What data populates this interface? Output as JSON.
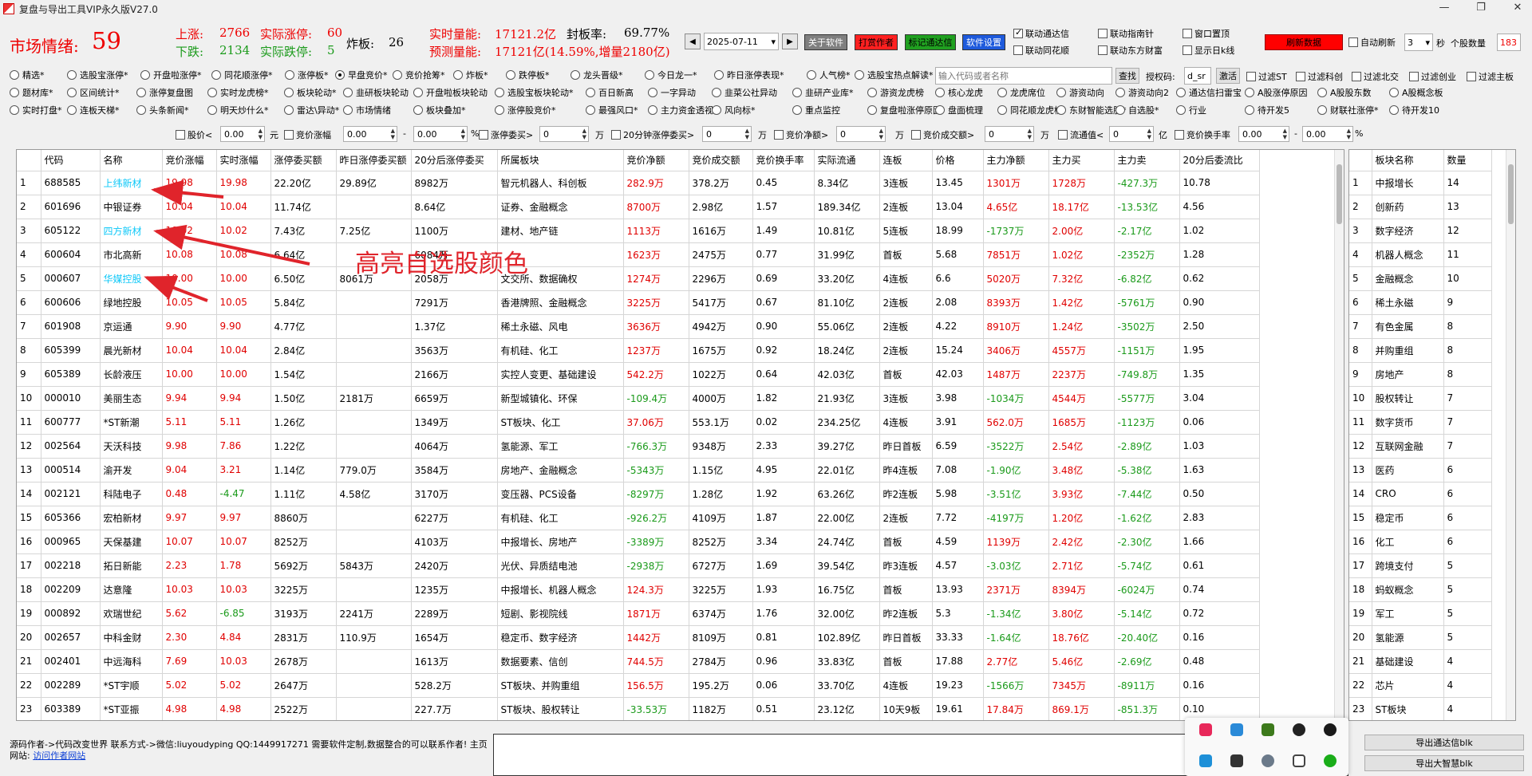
{
  "window": {
    "title": "复盘与导出工具VIP永久版V27.0"
  },
  "header": {
    "mood_label": "市场情绪:",
    "mood_value": "59",
    "up_label": "上涨:",
    "up_value": "2766",
    "real_limit_up_label": "实际涨停:",
    "real_limit_up_value": "60",
    "down_label": "下跌:",
    "down_value": "2134",
    "real_limit_down_label": "实际跌停:",
    "real_limit_down_value": "5",
    "broken_label": "炸板:",
    "broken_value": "26",
    "realtime_vol_label": "实时量能:",
    "realtime_vol_value": "17121.2亿",
    "seal_rate_label": "封板率:",
    "seal_rate_value": "69.77%",
    "forecast_vol_label": "预测量能:",
    "forecast_vol_value": "17121亿(14.59%,增量2180亿)"
  },
  "toolbar": {
    "date": "2025-07-11",
    "about": "关于软件",
    "tip": "打赏作者",
    "mark_tdx": "标记通达信",
    "settings": "软件设置",
    "link_tdx": "联动通达信",
    "link_tonghuashun": "联动同花顺",
    "link_compass": "联动指南针",
    "link_eastmoney": "联动东方财富",
    "window_top": "窗口置顶",
    "show_k": "显示日k线",
    "refresh": "刷新数据",
    "auto_refresh": "自动刷新",
    "interval": "3",
    "sec": "秒",
    "count_label": "个股数量",
    "count": "183"
  },
  "radios": {
    "row1": [
      "精选*",
      "选股宝涨停*",
      "开盘啦涨停*",
      "同花顺涨停*",
      "涨停板*",
      "早盘竞价*",
      "竞价抢筹*",
      "炸板*",
      "跌停板*",
      "龙头晋级*",
      "今日龙一*",
      "昨日涨停表现*",
      "人气榜*",
      "选股宝热点解读*"
    ],
    "row2": [
      "题材库*",
      "区间统计*",
      "涨停复盘图",
      "实时龙虎榜*",
      "板块轮动*",
      "韭研板块轮动",
      "开盘啦板块轮动",
      "选股宝板块轮动*",
      "百日新高",
      "一字异动",
      "韭菜公社异动",
      "韭研产业库*",
      "游资龙虎榜",
      "核心龙虎",
      "龙虎席位",
      "游资动向",
      "游资动向2",
      "通达信扫雷宝",
      "A股涨停原因",
      "A股股东数",
      "A股概念板"
    ],
    "row3": [
      "实时打盘*",
      "连板天梯*",
      "头条新闻*",
      "明天炒什么*",
      "雷达\\异动*",
      "市场情绪",
      "板块叠加*",
      "涨停股竞价*",
      "最强风口*",
      "主力资金透视*",
      "风向标*",
      "重点监控",
      "复盘啦涨停原因",
      "盘面梳理",
      "同花顺龙虎榜",
      "东财智能选股*",
      "自选股*",
      "行业",
      "待开发5",
      "财联社涨停*",
      "待开发10"
    ],
    "search_placeholder": "输入代码或者名称",
    "search_btn": "查找",
    "auth_label": "授权码:",
    "auth_value": "d_sr",
    "activate_btn": "激活",
    "filters_right": [
      "过滤ST",
      "过滤科创",
      "过滤北交",
      "过滤创业",
      "过滤主板"
    ]
  },
  "filters": {
    "price_label": "股价<",
    "price_val": "0.00",
    "yuan": "元",
    "bid_change_label": "竞价涨幅",
    "bid_change_min": "0.00",
    "dash": "-",
    "bid_change_max": "0.00",
    "pct": "%",
    "limit_order_label": "涨停委买>",
    "limit_order_val": "0",
    "wan1": "万",
    "order20_label": "20分钟涨停委买>",
    "order20_val": "0",
    "wan2": "万",
    "bid_net_label": "竞价净额>",
    "bid_net_val": "0",
    "wan3": "万",
    "bid_amount_label": "竞价成交额>",
    "bid_amount_val": "0",
    "wan4": "万",
    "float_label": "流通值<",
    "float_val": "0",
    "yi": "亿",
    "turnover_label": "竞价换手率",
    "turnover_min": "0.00",
    "dash2": "-",
    "turnover_max": "0.00",
    "pct2": "%"
  },
  "table": {
    "columns": [
      "",
      "代码",
      "名称",
      "竞价涨幅",
      "实时涨幅",
      "涨停委买额",
      "昨日涨停委买额",
      "20分后涨停委买",
      "所属板块",
      "竞价净额",
      "竞价成交额",
      "竞价换手率",
      "实际流通",
      "连板",
      "价格",
      "主力净额",
      "主力买",
      "主力卖",
      "20分后委流比"
    ],
    "rows": [
      [
        "1",
        "688585",
        "上纬新材",
        "19.98",
        "19.98",
        "22.20亿",
        "29.89亿",
        "8982万",
        "智元机器人、科创板",
        "282.9万",
        "378.2万",
        "0.45",
        "8.34亿",
        "3连板",
        "13.45",
        "1301万",
        "1728万",
        "-427.3万",
        "10.78"
      ],
      [
        "2",
        "601696",
        "中银证券",
        "10.04",
        "10.04",
        "11.74亿",
        "",
        "8.64亿",
        "证券、金融概念",
        "8700万",
        "2.98亿",
        "1.57",
        "189.34亿",
        "2连板",
        "13.04",
        "4.65亿",
        "18.17亿",
        "-13.53亿",
        "4.56"
      ],
      [
        "3",
        "605122",
        "四方新材",
        "10.02",
        "10.02",
        "7.43亿",
        "7.25亿",
        "1100万",
        "建材、地产链",
        "1113万",
        "1616万",
        "1.49",
        "10.81亿",
        "5连板",
        "18.99",
        "-1737万",
        "2.00亿",
        "-2.17亿",
        "1.02"
      ],
      [
        "4",
        "600604",
        "市北高新",
        "10.08",
        "10.08",
        "6.64亿",
        "",
        "6084万",
        "",
        "1623万",
        "2475万",
        "0.77",
        "31.99亿",
        "首板",
        "5.68",
        "7851万",
        "1.02亿",
        "-2352万",
        "1.28"
      ],
      [
        "5",
        "000607",
        "华媒控股",
        "10.00",
        "10.00",
        "6.50亿",
        "8061万",
        "2058万",
        "文交所、数据确权",
        "1274万",
        "2296万",
        "0.69",
        "33.20亿",
        "4连板",
        "6.6",
        "5020万",
        "7.32亿",
        "-6.82亿",
        "0.62"
      ],
      [
        "6",
        "600606",
        "绿地控股",
        "10.05",
        "10.05",
        "5.84亿",
        "",
        "7291万",
        "香港牌照、金融概念",
        "3225万",
        "5417万",
        "0.67",
        "81.10亿",
        "2连板",
        "2.08",
        "8393万",
        "1.42亿",
        "-5761万",
        "0.90"
      ],
      [
        "7",
        "601908",
        "京运通",
        "9.90",
        "9.90",
        "4.77亿",
        "",
        "1.37亿",
        "稀土永磁、风电",
        "3636万",
        "4942万",
        "0.90",
        "55.06亿",
        "2连板",
        "4.22",
        "8910万",
        "1.24亿",
        "-3502万",
        "2.50"
      ],
      [
        "8",
        "605399",
        "晨光新材",
        "10.04",
        "10.04",
        "2.84亿",
        "",
        "3563万",
        "有机硅、化工",
        "1237万",
        "1675万",
        "0.92",
        "18.24亿",
        "2连板",
        "15.24",
        "3406万",
        "4557万",
        "-1151万",
        "1.95"
      ],
      [
        "9",
        "605389",
        "长龄液压",
        "10.00",
        "10.00",
        "1.54亿",
        "",
        "2166万",
        "实控人变更、基础建设",
        "542.2万",
        "1022万",
        "0.64",
        "42.03亿",
        "首板",
        "42.03",
        "1487万",
        "2237万",
        "-749.8万",
        "1.35"
      ],
      [
        "10",
        "000010",
        "美丽生态",
        "9.94",
        "9.94",
        "1.50亿",
        "2181万",
        "6659万",
        "新型城镇化、环保",
        "-109.4万",
        "4000万",
        "1.82",
        "21.93亿",
        "3连板",
        "3.98",
        "-1034万",
        "4544万",
        "-5577万",
        "3.04"
      ],
      [
        "11",
        "600777",
        "*ST新潮",
        "5.11",
        "5.11",
        "1.26亿",
        "",
        "1349万",
        "ST板块、化工",
        "37.06万",
        "553.1万",
        "0.02",
        "234.25亿",
        "4连板",
        "3.91",
        "562.0万",
        "1685万",
        "-1123万",
        "0.06"
      ],
      [
        "12",
        "002564",
        "天沃科技",
        "9.98",
        "7.86",
        "1.22亿",
        "",
        "4064万",
        "氢能源、军工",
        "-766.3万",
        "9348万",
        "2.33",
        "39.27亿",
        "昨日首板",
        "6.59",
        "-3522万",
        "2.54亿",
        "-2.89亿",
        "1.03"
      ],
      [
        "13",
        "000514",
        "渝开发",
        "9.04",
        "3.21",
        "1.14亿",
        "779.0万",
        "3584万",
        "房地产、金融概念",
        "-5343万",
        "1.15亿",
        "4.95",
        "22.01亿",
        "昨4连板",
        "7.08",
        "-1.90亿",
        "3.48亿",
        "-5.38亿",
        "1.63"
      ],
      [
        "14",
        "002121",
        "科陆电子",
        "0.48",
        "-4.47",
        "1.11亿",
        "4.58亿",
        "3170万",
        "变压器、PCS设备",
        "-8297万",
        "1.28亿",
        "1.92",
        "63.26亿",
        "昨2连板",
        "5.98",
        "-3.51亿",
        "3.93亿",
        "-7.44亿",
        "0.50"
      ],
      [
        "15",
        "605366",
        "宏柏新材",
        "9.97",
        "9.97",
        "8860万",
        "",
        "6227万",
        "有机硅、化工",
        "-926.2万",
        "4109万",
        "1.87",
        "22.00亿",
        "2连板",
        "7.72",
        "-4197万",
        "1.20亿",
        "-1.62亿",
        "2.83"
      ],
      [
        "16",
        "000965",
        "天保基建",
        "10.07",
        "10.07",
        "8252万",
        "",
        "4103万",
        "中报增长、房地产",
        "-3389万",
        "8252万",
        "3.34",
        "24.74亿",
        "首板",
        "4.59",
        "1139万",
        "2.42亿",
        "-2.30亿",
        "1.66"
      ],
      [
        "17",
        "002218",
        "拓日新能",
        "2.23",
        "1.78",
        "5692万",
        "5843万",
        "2420万",
        "光伏、异质结电池",
        "-2938万",
        "6727万",
        "1.69",
        "39.54亿",
        "昨3连板",
        "4.57",
        "-3.03亿",
        "2.71亿",
        "-5.74亿",
        "0.61"
      ],
      [
        "18",
        "002209",
        "达意隆",
        "10.03",
        "10.03",
        "3225万",
        "",
        "1235万",
        "中报增长、机器人概念",
        "124.3万",
        "3225万",
        "1.93",
        "16.75亿",
        "首板",
        "13.93",
        "2371万",
        "8394万",
        "-6024万",
        "0.74"
      ],
      [
        "19",
        "000892",
        "欢瑞世纪",
        "5.62",
        "-6.85",
        "3193万",
        "2241万",
        "2289万",
        "短剧、影视院线",
        "1871万",
        "6374万",
        "1.76",
        "32.00亿",
        "昨2连板",
        "5.3",
        "-1.34亿",
        "3.80亿",
        "-5.14亿",
        "0.72"
      ],
      [
        "20",
        "002657",
        "中科金财",
        "2.30",
        "4.84",
        "2831万",
        "110.9万",
        "1654万",
        "稳定币、数字经济",
        "1442万",
        "8109万",
        "0.81",
        "102.89亿",
        "昨日首板",
        "33.33",
        "-1.64亿",
        "18.76亿",
        "-20.40亿",
        "0.16"
      ],
      [
        "21",
        "002401",
        "中远海科",
        "7.69",
        "10.03",
        "2678万",
        "",
        "1613万",
        "数据要素、信创",
        "744.5万",
        "2784万",
        "0.96",
        "33.83亿",
        "首板",
        "17.88",
        "2.77亿",
        "5.46亿",
        "-2.69亿",
        "0.48"
      ],
      [
        "22",
        "002289",
        "*ST宇顺",
        "5.02",
        "5.02",
        "2647万",
        "",
        "528.2万",
        "ST板块、并购重组",
        "156.5万",
        "195.2万",
        "0.06",
        "33.70亿",
        "4连板",
        "19.23",
        "-1566万",
        "7345万",
        "-8911万",
        "0.16"
      ],
      [
        "23",
        "603389",
        "*ST亚振",
        "4.98",
        "4.98",
        "2522万",
        "",
        "227.7万",
        "ST板块、股权转让",
        "-33.53万",
        "1182万",
        "0.51",
        "23.12亿",
        "10天9板",
        "19.61",
        "17.84万",
        "869.1万",
        "-851.3万",
        "0.10"
      ]
    ],
    "highlighted_names": [
      "上纬新材",
      "四方新材",
      "华媒控股"
    ]
  },
  "sectors": {
    "columns": [
      "",
      "板块名称",
      "数量"
    ],
    "rows": [
      [
        "1",
        "中报增长",
        "14"
      ],
      [
        "2",
        "创新药",
        "13"
      ],
      [
        "3",
        "数字经济",
        "12"
      ],
      [
        "4",
        "机器人概念",
        "11"
      ],
      [
        "5",
        "金融概念",
        "10"
      ],
      [
        "6",
        "稀土永磁",
        "9"
      ],
      [
        "7",
        "有色金属",
        "8"
      ],
      [
        "8",
        "并购重组",
        "8"
      ],
      [
        "9",
        "房地产",
        "8"
      ],
      [
        "10",
        "股权转让",
        "7"
      ],
      [
        "11",
        "数字货币",
        "7"
      ],
      [
        "12",
        "互联网金融",
        "7"
      ],
      [
        "13",
        "医药",
        "6"
      ],
      [
        "14",
        "CRO",
        "6"
      ],
      [
        "15",
        "稳定币",
        "6"
      ],
      [
        "16",
        "化工",
        "6"
      ],
      [
        "17",
        "跨境支付",
        "5"
      ],
      [
        "18",
        "蚂蚁概念",
        "5"
      ],
      [
        "19",
        "军工",
        "5"
      ],
      [
        "20",
        "氢能源",
        "5"
      ],
      [
        "21",
        "基础建设",
        "4"
      ],
      [
        "22",
        "芯片",
        "4"
      ],
      [
        "23",
        "ST板块",
        "4"
      ]
    ]
  },
  "annotation": {
    "text": "高亮自选股颜色"
  },
  "footer": {
    "line1": "源码作者->代码改变世界 联系方式->微信:liuyoudyping QQ:1449917271 需要软件定制,数据整合的可以联系作者! 主页网站:",
    "link": "访问作者网站",
    "export_tdx": "导出通达信blk",
    "export_dzh": "导出大智慧blk"
  },
  "colors": {
    "up": "#e00000",
    "down": "#1a9a1a",
    "highlight": "#0fc8f8",
    "refresh_btn": "#ff0000",
    "about_btn": "#7f7f7f",
    "tip_btn": "#ff2020",
    "mark_btn": "#20a020",
    "settings_btn": "#1e5adc"
  }
}
